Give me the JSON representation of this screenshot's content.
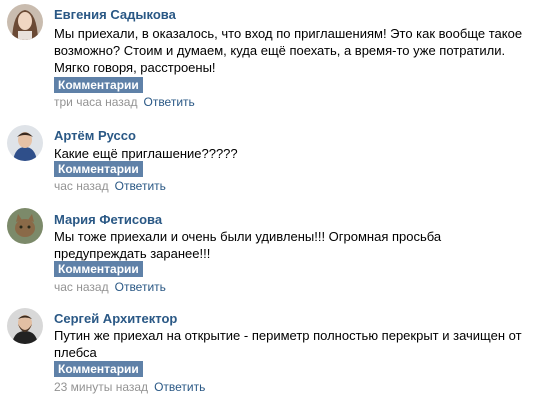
{
  "comments": [
    {
      "author": "Евгения Садыкова",
      "text": "Мы приехали, в оказалось, что вход по приглашениям! Это как вообще такое возможно? Стоим и думаем, куда ещё поехать, а время-то уже потратили. Мягко говоря, расстроены!",
      "button_label": "Комментарии",
      "time": "три часа назад",
      "reply_label": "Ответить"
    },
    {
      "author": "Артём Руссо",
      "text": "Какие ещё приглашение?????",
      "button_label": "Комментарии",
      "time": "час назад",
      "reply_label": "Ответить"
    },
    {
      "author": "Мария Фетисова",
      "text": "Мы тоже приехали и очень были удивлены!!! Огромная просьба предупреждать заранее!!!",
      "button_label": "Комментарии",
      "time": "час назад",
      "reply_label": "Ответить"
    },
    {
      "author": "Сергей Архитектор",
      "text": "Путин же приехал на открытие - периметр полностью перекрыт и зачищен от плебса",
      "button_label": "Комментарии",
      "time": "23 минуты назад",
      "reply_label": "Ответить"
    }
  ],
  "colors": {
    "author_link": "#2a5885",
    "button_bg": "#5f81a8",
    "timestamp": "#939393"
  }
}
